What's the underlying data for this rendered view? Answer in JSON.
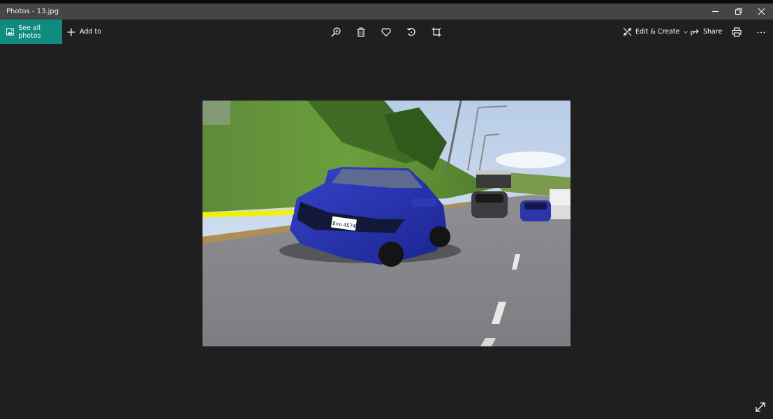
{
  "window": {
    "title": "Photos - 13.jpg"
  },
  "toolbar": {
    "see_all_label": "See all photos",
    "add_to_label": "Add to",
    "edit_create_label": "Edit & Create",
    "share_label": "Share"
  },
  "photo": {
    "plate_text": "8กฉ 4574"
  },
  "colors": {
    "accent": "#0f8b80",
    "titlebar": "#454545",
    "background": "#1f1f1f",
    "highlight": "#f2f200"
  },
  "icons": [
    "gallery-icon",
    "plus-icon",
    "zoom-icon",
    "delete-icon",
    "favorite-icon",
    "rotate-icon",
    "crop-icon",
    "edit-create-icon",
    "chevron-down-icon",
    "share-icon",
    "print-icon",
    "more-icon",
    "minimize-icon",
    "restore-icon",
    "close-icon",
    "fullscreen-icon"
  ]
}
